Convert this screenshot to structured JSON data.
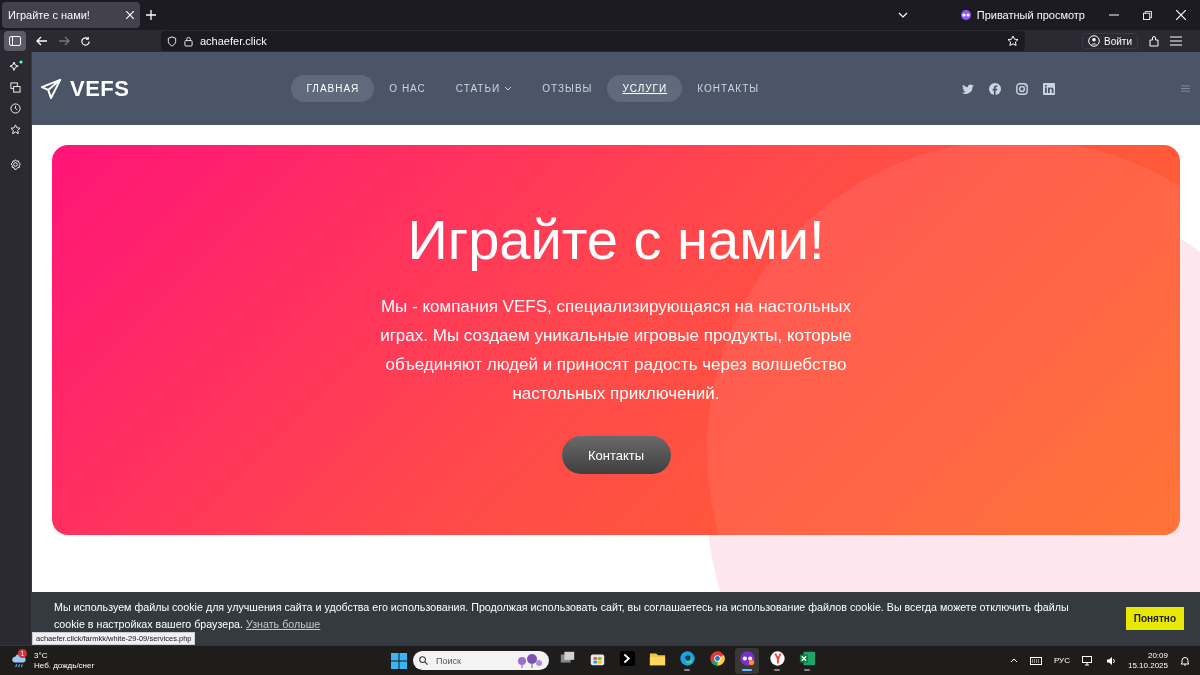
{
  "browser": {
    "tab": {
      "title": "Играйте с нами!",
      "selected": true
    },
    "private_label": "Приватный просмотр",
    "address": "achaefer.click",
    "sign_in": "Войти"
  },
  "site": {
    "logo": "VEFS",
    "nav": [
      {
        "label": "ГЛАВНАЯ",
        "highlighted": true,
        "selected": false,
        "submenu": false
      },
      {
        "label": "О НАС",
        "highlighted": false,
        "selected": false,
        "submenu": false
      },
      {
        "label": "СТАТЬИ",
        "highlighted": false,
        "selected": false,
        "submenu": true
      },
      {
        "label": "ОТЗЫВЫ",
        "highlighted": false,
        "selected": false,
        "submenu": false
      },
      {
        "label": "УСЛУГИ",
        "highlighted": true,
        "selected": true,
        "submenu": false
      },
      {
        "label": "КОНТАКТЫ",
        "highlighted": false,
        "selected": false,
        "submenu": false
      }
    ],
    "social": [
      {
        "kind": "twitter"
      },
      {
        "kind": "facebook"
      },
      {
        "kind": "instagram"
      },
      {
        "kind": "linkedin"
      }
    ]
  },
  "hero": {
    "title": "Играйте с нами!",
    "text": "Мы - компания VEFS, специализирующаяся на настольных играх. Мы создаем уникальные игровые продукты, которые объединяют людей и приносят радость через волшебство настольных приключений.",
    "button": "Контакты"
  },
  "cookie_banner": {
    "text": "Мы используем файлы cookie для улучшения сайта и удобства его использования. Продолжая использовать сайт, вы соглашаетесь на использование файлов cookie. Вы всегда можете отключить файлы cookie в настройках вашего браузера.",
    "link": "Узнать больше",
    "button": "Понятно"
  },
  "status_url": "achaefer.click/farmkk/white-29-09/services.php",
  "taskbar": {
    "weather": {
      "badge": "1",
      "temperature": "3°C",
      "condition": "Неб. дождь/снег"
    },
    "search": {
      "placeholder": "Поиск"
    },
    "apps": [
      {
        "kind": "taskview",
        "running": false,
        "selected": false
      },
      {
        "kind": "store",
        "running": false,
        "selected": false
      },
      {
        "kind": "terminal",
        "running": false,
        "selected": false
      },
      {
        "kind": "folder",
        "running": false,
        "selected": false
      },
      {
        "kind": "edge",
        "running": true,
        "selected": false
      },
      {
        "kind": "chrome",
        "running": false,
        "selected": false
      },
      {
        "kind": "private",
        "running": true,
        "selected": true
      },
      {
        "kind": "yandex",
        "running": true,
        "selected": false
      },
      {
        "kind": "excel",
        "running": true,
        "selected": false
      }
    ],
    "language": "РУС",
    "time": "20:09",
    "date": "15.10.2025"
  }
}
